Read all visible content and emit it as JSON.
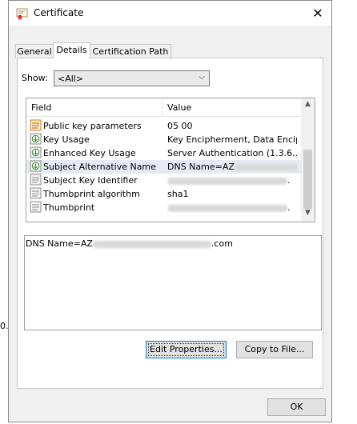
{
  "window": {
    "title": "Certificate"
  },
  "tabs": [
    {
      "label": "General"
    },
    {
      "label": "Details"
    },
    {
      "label": "Certification Path"
    }
  ],
  "show": {
    "label": "Show:",
    "selected": "<All>"
  },
  "grid": {
    "headers": {
      "field": "Field",
      "value": "Value"
    },
    "rows": [
      {
        "field": "Public key parameters",
        "value": "05 00"
      },
      {
        "field": "Key Usage",
        "value": "Key Encipherment, Data Encip..."
      },
      {
        "field": "Enhanced Key Usage",
        "value": "Server Authentication (1.3.6...."
      },
      {
        "field": "Subject Alternative Name",
        "value": "DNS Name=AZ"
      },
      {
        "field": "Subject Key Identifier",
        "value": "."
      },
      {
        "field": "Thumbprint algorithm",
        "value": "sha1"
      },
      {
        "field": "Thumbprint",
        "value": "."
      }
    ]
  },
  "detail": {
    "prefix": "DNS Name=AZ",
    "suffix": ".com"
  },
  "buttons": {
    "edit_properties": "Edit Properties...",
    "copy_to_file": "Copy to File...",
    "ok": "OK"
  },
  "background": {
    "left_edge_text": "0.."
  },
  "colors": {
    "selected_row": "#e5eaf3",
    "default_button_border": "#0078d7"
  }
}
